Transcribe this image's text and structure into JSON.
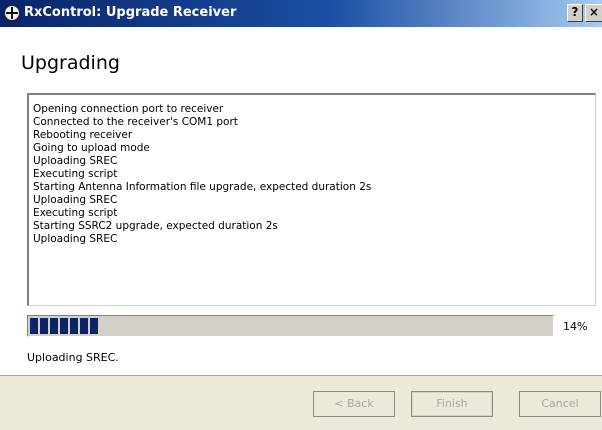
{
  "window": {
    "title": "RxControl: Upgrade Receiver",
    "help_button": "?",
    "close_button": "×"
  },
  "header": {
    "title": "Upgrading"
  },
  "log": {
    "lines": [
      "Opening connection port to receiver",
      "Connected to the receiver's COM1 port",
      "Rebooting receiver",
      "Going to upload mode",
      "Uploading SREC",
      "Executing script",
      "Starting Antenna Information file upgrade, expected duration 2s",
      "Uploading SREC",
      "Executing script",
      "Starting SSRC2 upgrade, expected duration 2s",
      "Uploading SREC"
    ]
  },
  "progress": {
    "percent_label": "14%",
    "fraction": 0.14,
    "fill_color": "#0a246a"
  },
  "status": {
    "text": "Uploading SREC."
  },
  "buttons": {
    "back_label": "< Back",
    "finish_label": "Finish",
    "cancel_label": "Cancel"
  }
}
